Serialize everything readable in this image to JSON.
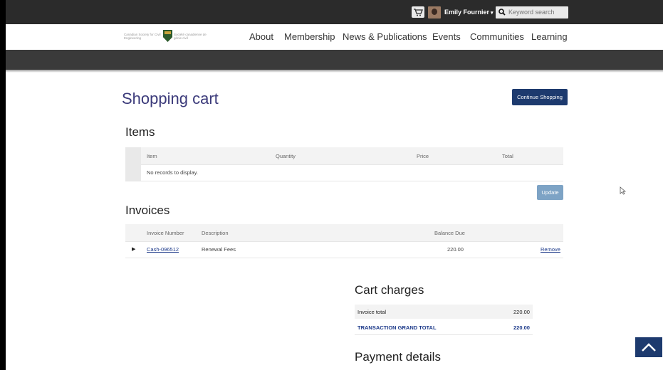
{
  "topbar": {
    "user_name": "Emily Fournier",
    "user_caret": "▾",
    "search_placeholder": "Keyword search"
  },
  "logo": {
    "left_text": "Canadian Society for Civil Engineering",
    "right_text": "Société canadienne de génie civil"
  },
  "nav": {
    "items": [
      "About",
      "Membership",
      "News & Publications",
      "Events",
      "Communities",
      "Learning"
    ]
  },
  "page": {
    "title": "Shopping cart",
    "continue_label": "Continue Shopping"
  },
  "items": {
    "heading": "Items",
    "columns": [
      "Item",
      "Quantity",
      "Price",
      "Total"
    ],
    "empty_message": "No records to display.",
    "update_label": "Update"
  },
  "invoices": {
    "heading": "Invoices",
    "columns": [
      "Invoice Number",
      "Description",
      "Balance Due"
    ],
    "rows": [
      {
        "number": "Cash-096512",
        "description": "Renewal Fees",
        "balance": "220.00",
        "action": "Remove"
      }
    ]
  },
  "charges": {
    "heading": "Cart charges",
    "invoice_total_label": "Invoice total",
    "invoice_total_value": "220.00",
    "grand_total_label": "TRANSACTION GRAND TOTAL",
    "grand_total_value": "220.00"
  },
  "payment": {
    "heading": "Payment details"
  },
  "colors": {
    "accent": "#1d3a6e",
    "title": "#3b3a7a",
    "update_button": "#7da3c5"
  }
}
